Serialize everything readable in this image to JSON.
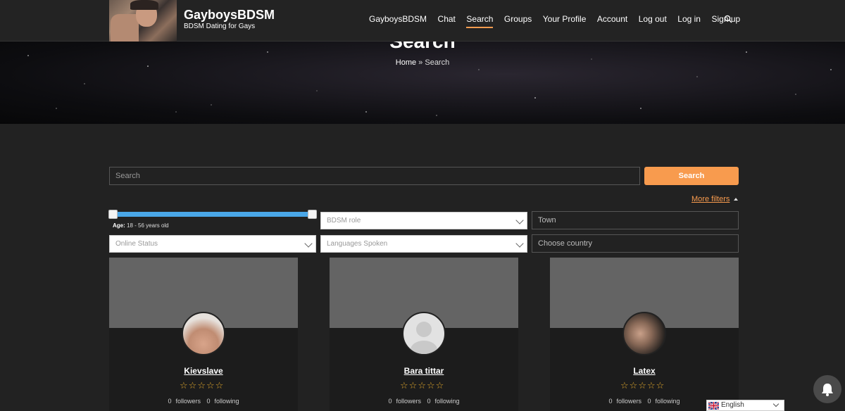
{
  "header": {
    "site_title": "GayboysBDSM",
    "site_tagline": "BDSM Dating for Gays",
    "nav": [
      {
        "label": "GayboysBDSM",
        "active": false
      },
      {
        "label": "Chat",
        "active": false
      },
      {
        "label": "Search",
        "active": true
      },
      {
        "label": "Groups",
        "active": false
      },
      {
        "label": "Your Profile",
        "active": false
      },
      {
        "label": "Account",
        "active": false
      },
      {
        "label": "Log out",
        "active": false
      },
      {
        "label": "Log in",
        "active": false
      },
      {
        "label": "Sign up",
        "active": false
      }
    ],
    "search_icon": "search-icon"
  },
  "hero": {
    "title": "Search",
    "breadcrumb_home": "Home",
    "breadcrumb_sep": "»",
    "breadcrumb_current": "Search"
  },
  "search": {
    "placeholder": "Search",
    "button_label": "Search",
    "more_filters": "More filters"
  },
  "filters": {
    "age_label": "Age:",
    "age_min": "18",
    "age_max": "56",
    "age_suffix": "years old",
    "bdsm_role": "BDSM role",
    "town": "Town",
    "online_status": "Online Status",
    "languages": "Languages Spoken",
    "country": "Choose country"
  },
  "members": [
    {
      "name": "Kievslave",
      "followers": "0",
      "followers_label": "followers",
      "following": "0",
      "following_label": "following",
      "rating": 0
    },
    {
      "name": "Bara tittar",
      "followers": "0",
      "followers_label": "followers",
      "following": "0",
      "following_label": "following",
      "rating": 0
    },
    {
      "name": "Latex",
      "followers": "0",
      "followers_label": "followers",
      "following": "0",
      "following_label": "following",
      "rating": 0
    }
  ],
  "language": {
    "label": "English"
  },
  "colors": {
    "accent": "#f89b4e",
    "slider": "#4aa7e8",
    "star": "#e0a72c"
  }
}
